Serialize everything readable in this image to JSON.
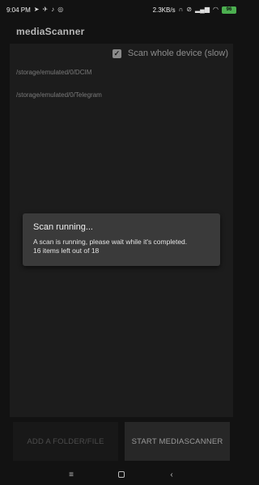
{
  "status_bar": {
    "time": "9:04 PM",
    "left_icons": [
      "navigation-icon",
      "telegram-icon",
      "tiktok-icon",
      "whatsapp-icon"
    ],
    "network_speed": "2.3KB/s",
    "right_icons": [
      "headphone-icon",
      "dnd-icon",
      "signal-icon",
      "wifi-icon"
    ],
    "battery": "96"
  },
  "app": {
    "title": "mediaScanner"
  },
  "scan_option": {
    "label": "Scan whole device (slow)",
    "checked": true
  },
  "folders": [
    "/storage/emulated/0/DCIM",
    "/storage/emulated/0/Telegram"
  ],
  "buttons": {
    "add_folder": "ADD A FOLDER/FILE",
    "start": "START MEDIASCANNER"
  },
  "dialog": {
    "title": "Scan running...",
    "message": "A scan is running, please wait while it's completed.",
    "progress": "16 items left out of 18"
  },
  "nav_icons": [
    "recents-icon",
    "home-icon",
    "back-icon"
  ]
}
